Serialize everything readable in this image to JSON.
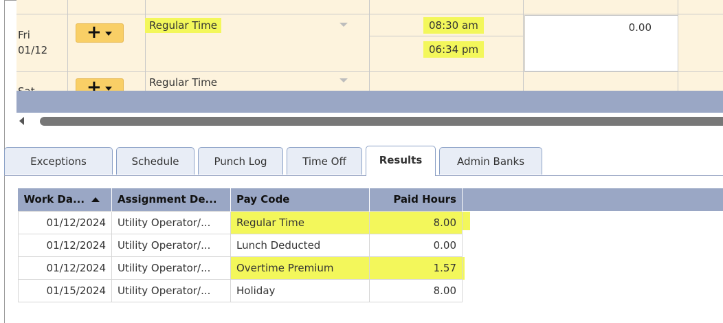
{
  "timesheet": {
    "rows": [
      {
        "day": "Fri",
        "date": "01/12",
        "pay_code": "Regular Time",
        "punch_in": "08:30 am",
        "punch_out": "06:34 pm",
        "hours": "0.00"
      },
      {
        "day": "Sat",
        "pay_code": "Regular Time"
      }
    ],
    "add_icon": "plus-icon",
    "highlight_color": "#f3f75b"
  },
  "tabs": [
    {
      "label": "Exceptions"
    },
    {
      "label": "Schedule"
    },
    {
      "label": "Punch Log"
    },
    {
      "label": "Time Off"
    },
    {
      "label": "Results",
      "active": true
    },
    {
      "label": "Admin Banks"
    }
  ],
  "results": {
    "headers": [
      "Work Da...",
      "Assignment De...",
      "Pay Code",
      "Paid Hours"
    ],
    "rows": [
      {
        "work_date": "01/12/2024",
        "assignment": "Utility Operator/...",
        "pay_code": "Regular Time",
        "paid_hours": "8.00"
      },
      {
        "work_date": "01/12/2024",
        "assignment": "Utility Operator/...",
        "pay_code": "Lunch Deducted",
        "paid_hours": "0.00"
      },
      {
        "work_date": "01/12/2024",
        "assignment": "Utility Operator/...",
        "pay_code": "Overtime Premium",
        "paid_hours": "1.57"
      },
      {
        "work_date": "01/15/2024",
        "assignment": "Utility Operator/...",
        "pay_code": "Holiday",
        "paid_hours": "8.00"
      }
    ]
  },
  "colors": {
    "header_blue": "#9aa7c5",
    "row_bg": "#fdf3dd",
    "button_gold": "#f9cf66"
  }
}
